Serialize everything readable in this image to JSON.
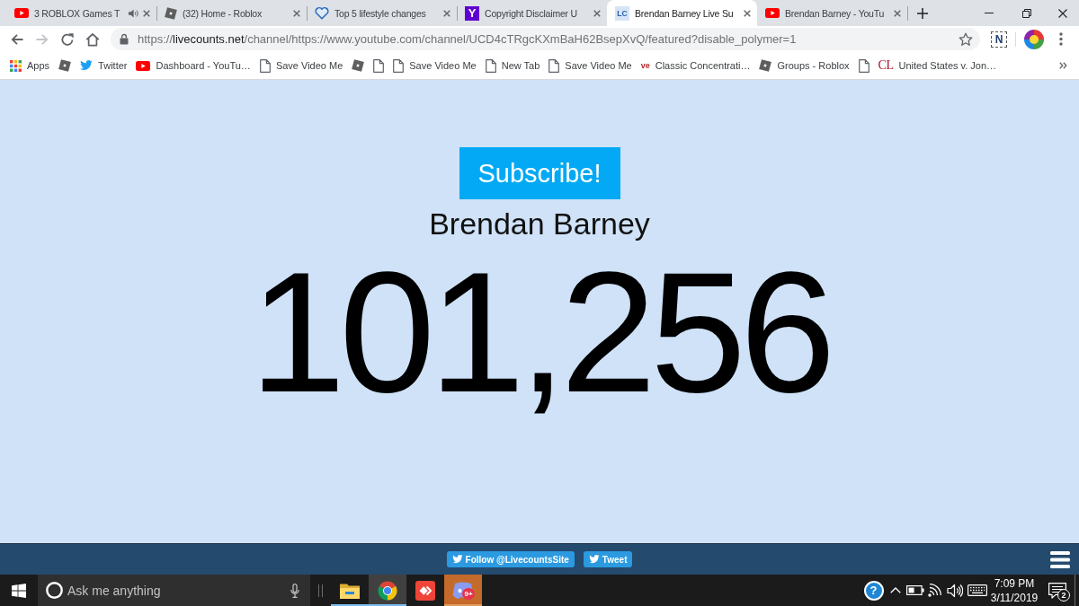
{
  "browser": {
    "tabs": [
      {
        "kind": "youtube",
        "title": "3 ROBLOX Games T",
        "audio": true,
        "selected": false
      },
      {
        "kind": "roblox",
        "title": "(32) Home - Roblox",
        "audio": false,
        "selected": false
      },
      {
        "kind": "heart",
        "title": "Top 5 lifestyle changes",
        "audio": false,
        "selected": false
      },
      {
        "kind": "purple-tile",
        "icon_text": "Y",
        "title": "Copyright Disclaimer U",
        "audio": false,
        "selected": false
      },
      {
        "kind": "pale-tile",
        "icon_text": "LC",
        "title": "Brendan Barney Live Su",
        "audio": false,
        "selected": true
      },
      {
        "kind": "youtube",
        "title": "Brendan Barney - YouTu",
        "audio": false,
        "selected": false
      }
    ],
    "toolbar": {
      "nav": [
        {
          "kind": "back",
          "disabled": false
        },
        {
          "kind": "forward",
          "disabled": true
        },
        {
          "kind": "reload",
          "disabled": false
        },
        {
          "kind": "home",
          "disabled": false
        }
      ],
      "address": {
        "scheme": "https://",
        "host": "livecounts.net",
        "path": "/channel/https://www.youtube.com/channel/UCD4cTRgcKXmBaH62BsepXvQ/featured?disable_polymer=1"
      },
      "bookmarked": false,
      "extension_text": "N"
    },
    "bookmarks": [
      {
        "kind": "apps",
        "label": "Apps"
      },
      {
        "kind": "roblox"
      },
      {
        "kind": "twitter",
        "label": "Twitter"
      },
      {
        "kind": "youtube",
        "label": "Dashboard - YouTu…"
      },
      {
        "kind": "page",
        "label": "Save Video Me"
      },
      {
        "kind": "roblox"
      },
      {
        "kind": "page"
      },
      {
        "kind": "page",
        "label": "Save Video Me"
      },
      {
        "kind": "page",
        "label": "New Tab"
      },
      {
        "kind": "page",
        "label": "Save Video Me"
      },
      {
        "kind": "small-letters",
        "icon_text": "ve",
        "label": "Classic Concentrati…"
      },
      {
        "kind": "roblox",
        "label": "Groups - Roblox"
      },
      {
        "kind": "page"
      },
      {
        "kind": "serif-letters",
        "icon_text": "CL",
        "label": "United States v. Jon…"
      }
    ]
  },
  "page": {
    "subscribe_button": "Subscribe!",
    "channel_name": "Brendan Barney",
    "subscriber_count": "101,256"
  },
  "footer": {
    "buttons": [
      {
        "label": "Follow @LivecountsSite"
      },
      {
        "label": "Tweet"
      }
    ]
  },
  "taskbar": {
    "search": {
      "placeholder": "Ask me anything"
    },
    "apps": [
      {
        "kind": "file-explorer",
        "running": true,
        "selected": false,
        "flashing": false
      },
      {
        "kind": "chrome",
        "running": true,
        "selected": true,
        "flashing": false
      },
      {
        "kind": "red-app",
        "running": false,
        "selected": false,
        "flashing": false
      },
      {
        "kind": "chat-app",
        "running": true,
        "selected": false,
        "flashing": true,
        "badge": "9+"
      }
    ],
    "tray": {
      "help_glyph": "?",
      "time": "7:09 PM",
      "date": "3/11/2019",
      "notification_count": "2"
    }
  }
}
